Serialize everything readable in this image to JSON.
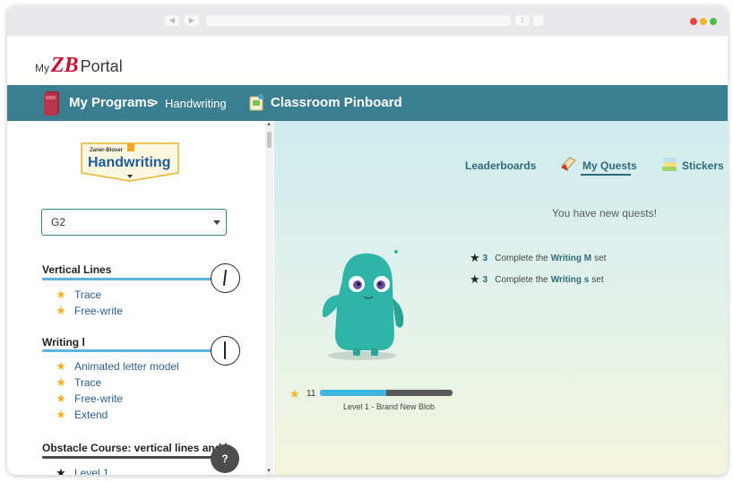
{
  "portal": {
    "logo_my": "My",
    "logo_zb": "ZB",
    "logo_portal": "Portal"
  },
  "nav": {
    "programs": "My Programs",
    "separator": ">",
    "handwriting": "Handwriting",
    "pinboard": "Classroom Pinboard"
  },
  "sidebar": {
    "brand_small": "Zaner-Bloser",
    "brand_main": "Handwriting",
    "grade": "G2",
    "help": "?",
    "sections": [
      {
        "title": "Vertical Lines",
        "lessons": [
          "Trace",
          "Free-write"
        ]
      },
      {
        "title": "Writing l",
        "lessons": [
          "Animated letter model",
          "Trace",
          "Free-write",
          "Extend"
        ]
      },
      {
        "title": "Obstacle Course: vertical lines and l",
        "lessons": [
          "Level 1"
        ]
      }
    ]
  },
  "main": {
    "tabs": [
      "Leaderboards",
      "My Quests",
      "Stickers"
    ],
    "active_tab": "My Quests",
    "new_quests": "You have new quests!",
    "quests": [
      {
        "count": "3",
        "prefix": "Complete the",
        "link": "Writing M",
        "suffix": "set"
      },
      {
        "count": "3",
        "prefix": "Complete the",
        "link": "Writing s",
        "suffix": "set"
      }
    ],
    "xp": "11",
    "xp_progress": 0.5,
    "level": "Level 1 - Brand New Blob"
  },
  "colors": {
    "navbar": "#3a7e8f",
    "accent": "#2f6a7c",
    "star_gold": "#f0b323",
    "logo_red": "#c8102e",
    "section_blue": "#57b4e3",
    "section_dark": "#4a4a4a",
    "blob": "#2eb5a8"
  }
}
